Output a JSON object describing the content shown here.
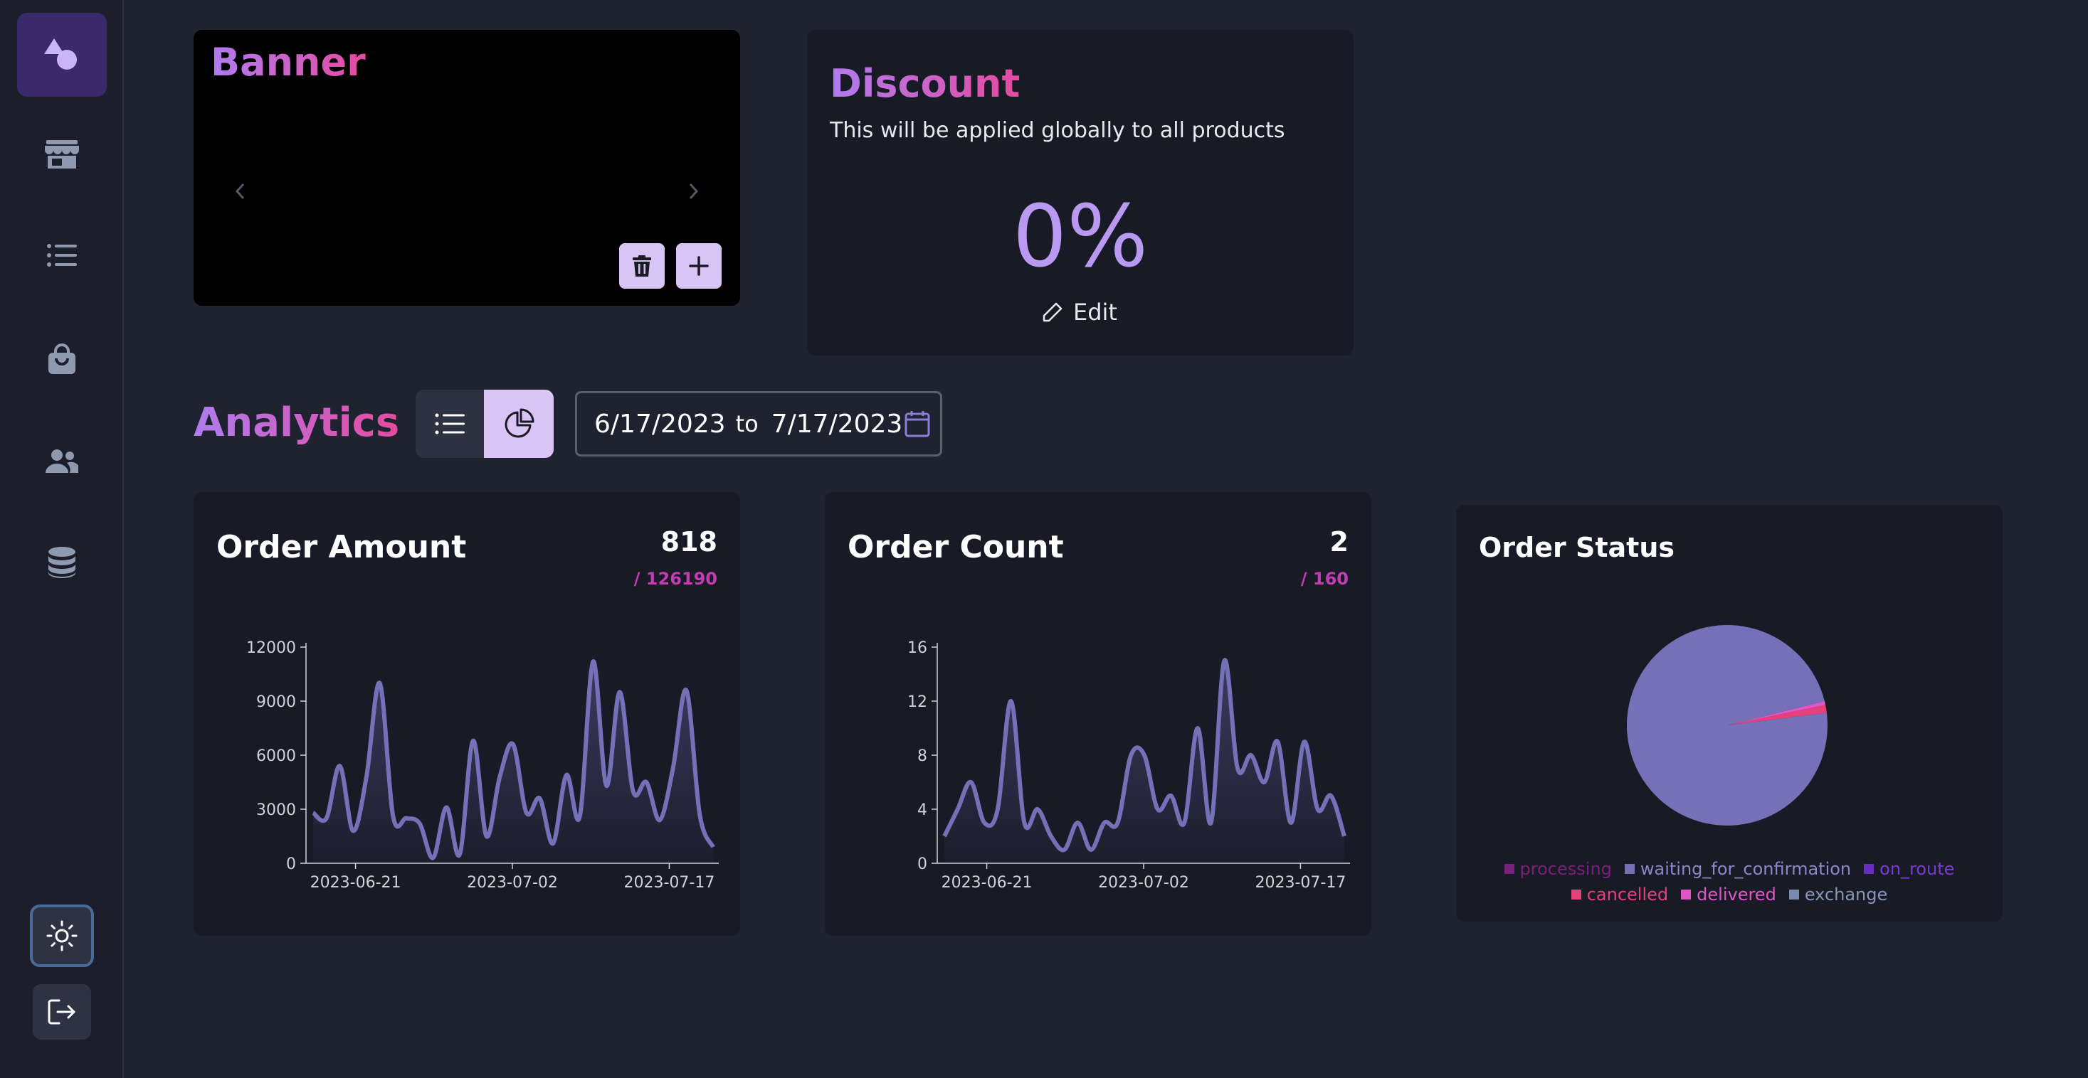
{
  "banner": {
    "title": "Banner"
  },
  "discount": {
    "title": "Discount",
    "description": "This will be applied globally to all products",
    "value": "0%",
    "edit_label": "Edit"
  },
  "analytics": {
    "title": "Analytics",
    "date_start": "6/17/2023",
    "date_connector": "to",
    "date_end": "7/17/2023"
  },
  "order_amount": {
    "title": "Order Amount",
    "value": "818",
    "total": "/ 126190"
  },
  "order_count": {
    "title": "Order Count",
    "value": "2",
    "total": "/ 160"
  },
  "order_status": {
    "title": "Order Status"
  },
  "colors": {
    "accent": "#d8c4f5",
    "line": "#7570b8",
    "processing": "#7a1f7a",
    "waiting_for_confirmation": "#7570b8",
    "on_route": "#6a2bbf",
    "cancelled": "#e6407a",
    "delivered": "#e055c8",
    "exchange": "#7a8ab0"
  },
  "chart_data": [
    {
      "type": "area",
      "title": "Order Amount",
      "ylim": [
        0,
        12000
      ],
      "yticks": [
        "0",
        "3000",
        "6000",
        "9000",
        "12000"
      ],
      "xticks": [
        "2023-06-21",
        "2023-07-02",
        "2023-07-17"
      ],
      "series": [
        {
          "values": [
            2800,
            2500,
            5400,
            1800,
            4800,
            10000,
            2600,
            2500,
            2200,
            300,
            3100,
            500,
            6800,
            1500,
            4800,
            6600,
            2800,
            3600,
            1100,
            4900,
            2600,
            11200,
            4300,
            9500,
            4000,
            4500,
            2400,
            5300,
            9600,
            2700,
            900
          ]
        }
      ]
    },
    {
      "type": "area",
      "title": "Order Count",
      "ylim": [
        0,
        16
      ],
      "yticks": [
        "0",
        "4",
        "8",
        "12",
        "16"
      ],
      "xticks": [
        "2023-06-21",
        "2023-07-02",
        "2023-07-17"
      ],
      "series": [
        {
          "values": [
            2,
            4,
            6,
            3,
            4,
            12,
            3,
            4,
            2,
            1,
            3,
            1,
            3,
            3,
            8,
            8,
            4,
            5,
            3,
            10,
            3,
            15,
            7,
            8,
            6,
            9,
            3,
            9,
            4,
            5,
            2
          ]
        }
      ]
    },
    {
      "type": "pie",
      "title": "Order Status",
      "categories": [
        "processing",
        "waiting_for_confirmation",
        "on_route",
        "cancelled",
        "delivered",
        "exchange"
      ],
      "values": [
        0,
        157,
        0,
        2,
        1,
        0
      ]
    }
  ]
}
